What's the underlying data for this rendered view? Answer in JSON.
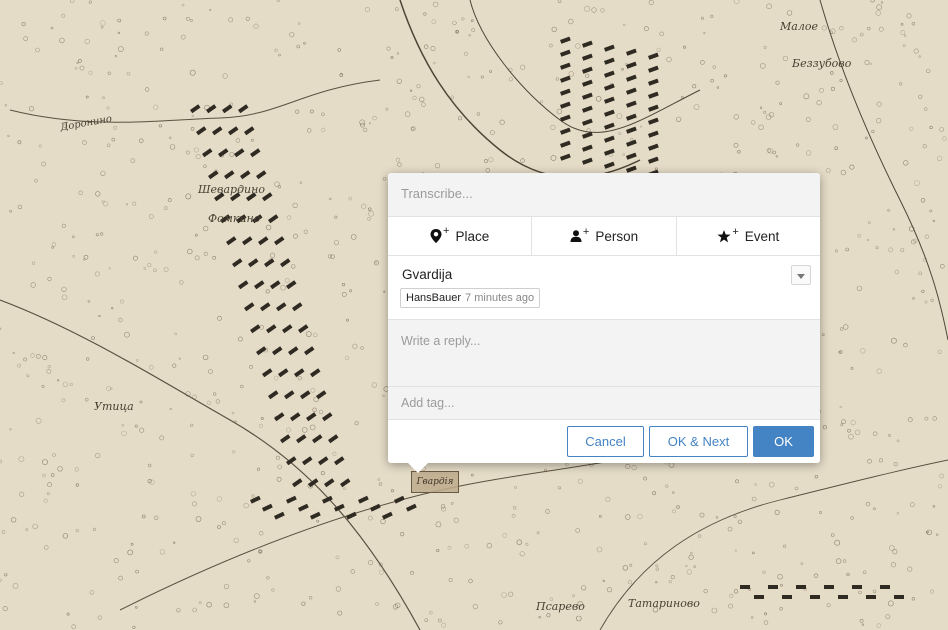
{
  "colors": {
    "accent": "#4483c4",
    "map_paper": "#e7dfcc",
    "map_ink": "#4a4033",
    "panel_gray": "#f3f3f3"
  },
  "map": {
    "labels": {
      "doronino": "Доронино",
      "shevardino": "Шевардино",
      "fomkino": "Фомкино",
      "utitsa": "Утица",
      "psarevo": "Псарево",
      "tatarinovo": "Татариново",
      "malaya": "Малое",
      "bezzubovo": "Беззубово"
    },
    "marker_label": "Гвардія"
  },
  "annotation": {
    "transcribe_placeholder": "Transcribe...",
    "tag_buttons": {
      "place": {
        "label": "Place",
        "icon": "map-marker-plus-icon"
      },
      "person": {
        "label": "Person",
        "icon": "user-plus-icon"
      },
      "event": {
        "label": "Event",
        "icon": "star-plus-icon"
      }
    },
    "plus_sign": "+",
    "comment": {
      "text": "Gvardija",
      "author": "HansBauer",
      "time": "7 minutes ago"
    },
    "reply_placeholder": "Write a reply...",
    "tag_placeholder": "Add tag...",
    "buttons": {
      "cancel": "Cancel",
      "ok_next": "OK & Next",
      "ok": "OK"
    }
  }
}
